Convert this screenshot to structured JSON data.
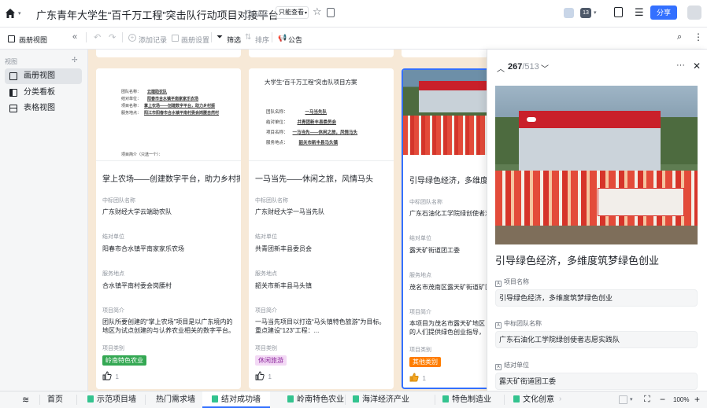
{
  "app": {
    "title": "广东青年大学生“百千万工程”突击队行动项目对接平台"
  },
  "titlebar": {
    "auth_label": "认证",
    "view_mode": "只能查看",
    "avatar_count": "13",
    "share_label": "分享",
    "colors": {
      "accent": "#3370ff"
    }
  },
  "toolbar": {
    "view_name": "画册视图",
    "add_record": "添加记录",
    "gallery_settings": "画册设置",
    "filter": "筛选",
    "sort": "排序",
    "announcement": "公告"
  },
  "sidebar": {
    "header": "视图",
    "items": [
      {
        "label": "画册视图"
      },
      {
        "label": "分类看板"
      },
      {
        "label": "表格视图"
      }
    ]
  },
  "cards": [
    {
      "title": "掌上农场——创建数字平台，助力乡村振兴",
      "f1_label": "中标团队名称",
      "f1_value": "广东财经大学云端助农队",
      "f2_label": "结对单位",
      "f2_value": "阳春市合水镇平南家家乐农场",
      "f3_label": "服务地点",
      "f3_value": "合水镇平南村委会岗腰村",
      "f4_label": "项目简介",
      "f4_value": "团队所要创建的“掌上农场”项目是以广东境内的地区为试点创建的与认养农业相关的数字平台。平台把试点...",
      "f5_label": "项目类别",
      "tag": "岭南特色农业",
      "likes": "1",
      "doc": {
        "lines": [
          {
            "k": "团队名称：",
            "v": "云端助农队"
          },
          {
            "k": "结对单位：",
            "v": "阳春市合水镇平南家家乐农场"
          },
          {
            "k": "项目名称：",
            "v": "掌上农场——创建数字平台，助力乡村振"
          },
          {
            "k": "服务地点：",
            "v": "阳江市阳春市合水镇平南村委会岗腰自然村"
          }
        ],
        "foot": "项目简介（只选一个）："
      }
    },
    {
      "title": "一马当先——休闲之旅，风情马头",
      "f1_label": "中标团队名称",
      "f1_value": "广东财经大学一马当先队",
      "f2_label": "结对单位",
      "f2_value": "共青团新丰县委员会",
      "f3_label": "服务地点",
      "f3_value": "韶关市新丰县马头镇",
      "f4_label": "项目简介",
      "f4_value": "一马当先项目以打造“马头镇特色旅游”为目标。重点建设“123”工程：...",
      "f5_label": "项目类别",
      "tag": "休闲旅游",
      "likes": "1",
      "doc": {
        "title": "大学生“百千万工程”突击队项目方案",
        "lines": [
          {
            "k": "团队名称：",
            "v": "一马当先队"
          },
          {
            "k": "结对单位：",
            "v": "共青团新丰县委员会"
          },
          {
            "k": "项目名称：",
            "v": "一马当先——休闲之旅，风情马头"
          },
          {
            "k": "服务地点：",
            "v": "韶关市新丰县马头镇"
          }
        ]
      }
    },
    {
      "title": "引导绿色经济，多维度筑梦绿色创业",
      "f1_label": "中标团队名称",
      "f1_value": "广东石油化工学院绿创使者志愿实践队",
      "f2_label": "结对单位",
      "f2_value": "露天矿街道团工委",
      "f3_label": "服务地点",
      "f3_value": "茂名市茂南区露天矿街道矿区社区",
      "f4_label": "项目简介",
      "f4_value": "本项目为茂名市露天矿地区的人们提供绿色创业指导，以绿色创业为核心...",
      "f5_label": "项目类别",
      "tag": "其他类别",
      "likes": "1"
    }
  ],
  "detail": {
    "counter_current": "267",
    "counter_total": "/513",
    "title": "引导绿色经济，多维度筑梦绿色创业",
    "fields": [
      {
        "label": "项目名称",
        "value": "引导绿色经济，多维度筑梦绿色创业"
      },
      {
        "label": "中标团队名称",
        "value": "广东石油化工学院绿创使者志愿实践队"
      },
      {
        "label": "结对单位",
        "value": "露天矿街道团工委"
      }
    ]
  },
  "bottombar": {
    "tabs": [
      {
        "label": "首页"
      },
      {
        "label": "示范项目墙"
      },
      {
        "label": "热门需求墙"
      },
      {
        "label": "结对成功墙"
      },
      {
        "label": "岭南特色农业"
      },
      {
        "label": "海洋经济产业"
      },
      {
        "label": "特色制造业"
      },
      {
        "label": "文化创意"
      }
    ],
    "zoom": "100%"
  }
}
